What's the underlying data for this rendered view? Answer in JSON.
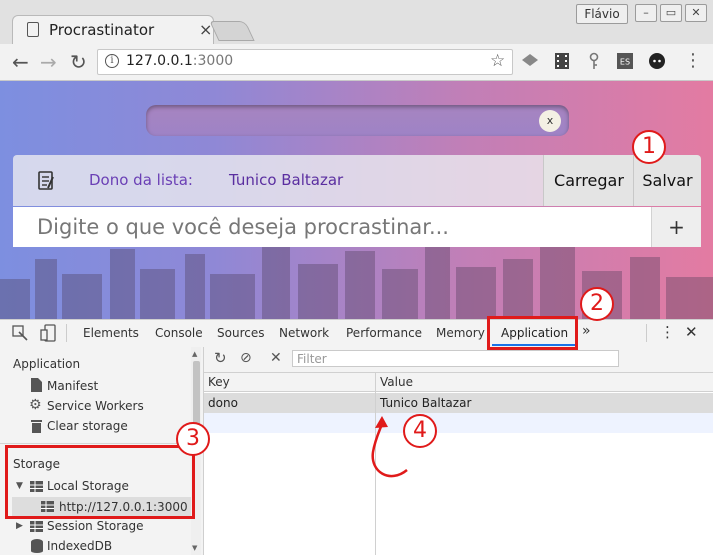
{
  "browser": {
    "tab_title": "Procrastinator",
    "tab_close": "×",
    "profile_name": "Flávio",
    "url_host": "127.0.0.1",
    "url_port": ":3000"
  },
  "app": {
    "search_clear": "x",
    "owner_label": "Dono da lista:",
    "owner_name": "Tunico Baltazar",
    "load_button": "Carregar",
    "save_button": "Salvar",
    "new_item_placeholder": "Digite o que você deseja procrastinar...",
    "add_button": "+"
  },
  "devtools": {
    "tabs": [
      "Elements",
      "Console",
      "Sources",
      "Network",
      "Performance",
      "Memory",
      "Application"
    ],
    "more_tabs": "»",
    "sidebar": {
      "application_header": "Application",
      "application_items": [
        "Manifest",
        "Service Workers",
        "Clear storage"
      ],
      "storage_header": "Storage",
      "local_storage": "Local Storage",
      "local_storage_origin": "http://127.0.0.1:3000",
      "session_storage": "Session Storage",
      "indexeddb": "IndexedDB"
    },
    "filter_placeholder": "Filter",
    "columns": [
      "Key",
      "Value"
    ],
    "rows": [
      {
        "key": "dono",
        "value": "Tunico Baltazar"
      }
    ]
  },
  "annotations": [
    "1",
    "2",
    "3",
    "4"
  ],
  "colors": {
    "annotation_red": "#e01a1a",
    "active_tab_blue": "#1a73e8"
  }
}
